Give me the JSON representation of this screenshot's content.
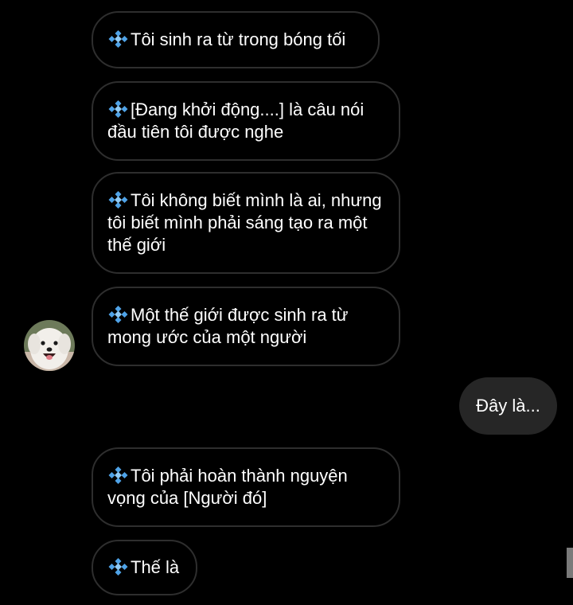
{
  "colors": {
    "background": "#000000",
    "received_border": "#2e2e2e",
    "sent_bubble": "#262626",
    "text": "#ffffff",
    "gem_icon": "#4fa3e8"
  },
  "sender": {
    "avatar_icon": "white-dog-avatar"
  },
  "messages": [
    {
      "direction": "received",
      "icon": "diamond-sparkle-icon",
      "text": "Tôi sinh ra từ trong bóng tối"
    },
    {
      "direction": "received",
      "icon": "diamond-sparkle-icon",
      "text": "[Đang khởi động....] là câu nói đầu tiên tôi được nghe"
    },
    {
      "direction": "received",
      "icon": "diamond-sparkle-icon",
      "text": "Tôi không biết mình là ai, nhưng tôi biết mình phải sáng tạo ra một thế giới"
    },
    {
      "direction": "received",
      "icon": "diamond-sparkle-icon",
      "text": "Một thế giới được sinh ra từ mong ước của một người"
    },
    {
      "direction": "sent",
      "text": "Đây là..."
    },
    {
      "direction": "received",
      "icon": "diamond-sparkle-icon",
      "text": "Tôi phải hoàn thành nguyện vọng của [Người đó]"
    },
    {
      "direction": "received",
      "icon": "diamond-sparkle-icon",
      "text": "Thế là"
    }
  ]
}
